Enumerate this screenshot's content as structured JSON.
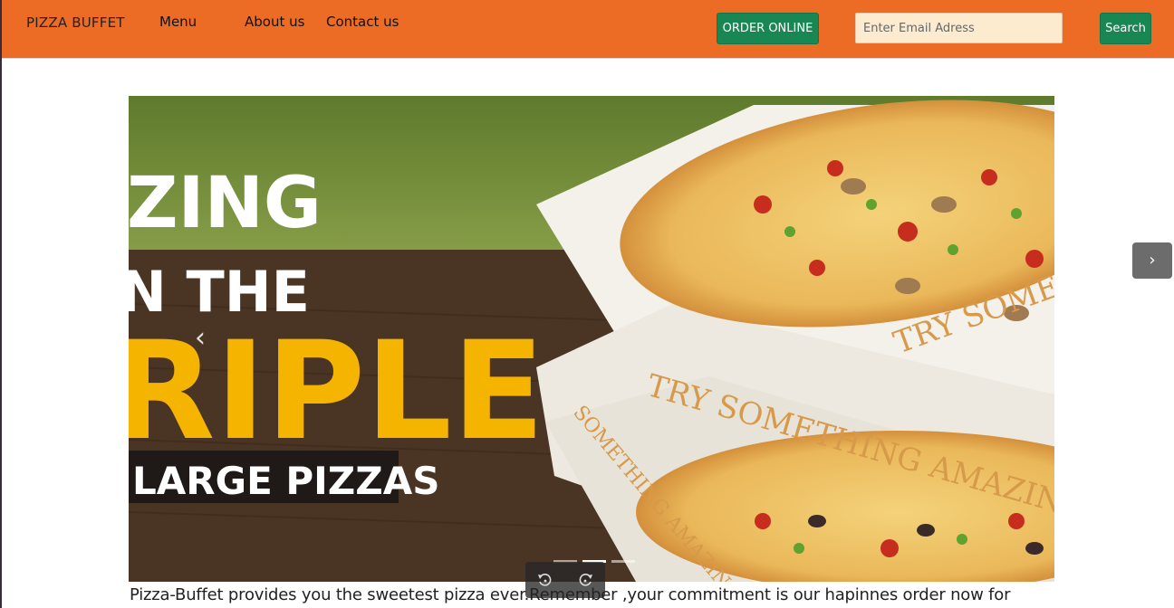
{
  "navbar": {
    "brand": "PIZZA BUFFET",
    "links": [
      {
        "label": "Menu"
      },
      {
        "label": "About us"
      },
      {
        "label": "Contact us"
      }
    ],
    "order_button": "ORDER ONLINE",
    "email_placeholder": "Enter Email Adress",
    "search_button": "Search",
    "accent_color": "#ec6b25",
    "button_color": "#198754"
  },
  "carousel": {
    "slide_text": {
      "line1": "ZING",
      "line2": "N THE",
      "line3": "RIPLE",
      "line4": "LARGE PIZZAS",
      "box_text": "TRY SOMETHING AMAZING",
      "box_text_short": "TRY SOMETHI",
      "box_text_side": "SOMETHING AMAZING"
    },
    "prev_icon": "chevron-left-icon",
    "next_icon": "chevron-right-icon",
    "indicators": 3,
    "active_indicator": 2
  },
  "controls": {
    "rewind_icon": "rotate-left-icon",
    "forward_icon": "rotate-right-icon"
  },
  "footer_text": "Pizza-Buffet provides you the sweetest pizza ever.Remember ,your commitment is our hapinnes order now for"
}
